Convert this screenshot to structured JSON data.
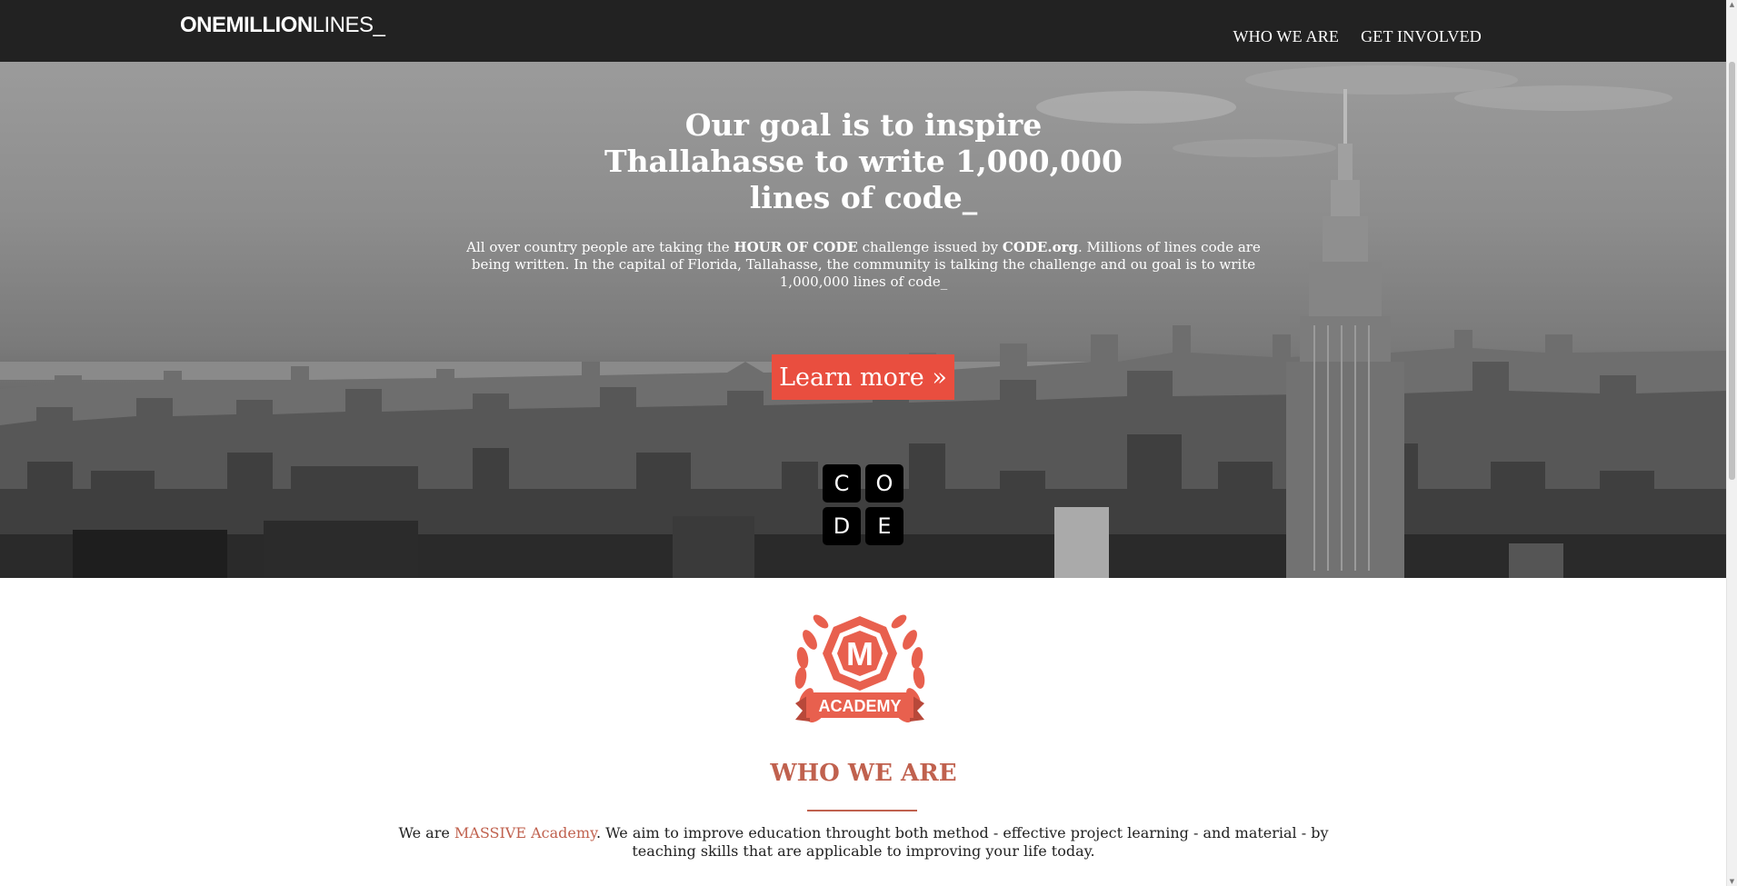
{
  "navbar": {
    "brand_bold": "ONEMILLION",
    "brand_light": "LINES_",
    "links": [
      {
        "label": "WHO WE ARE"
      },
      {
        "label": "GET INVOLVED"
      }
    ]
  },
  "hero": {
    "title_line1": "Our goal is to inspire",
    "title_line2": "Thallahasse to write 1,000,000",
    "title_line3": "lines of code_",
    "text_part1": "All over country people are taking the ",
    "text_bold1": "HOUR OF CODE",
    "text_part2": " challenge issued by ",
    "text_bold2": "CODE.org",
    "text_part3": ". Millions of lines code are being written. In the capital of Florida, Tallahasse, the community is talking the challenge and ou goal is to write 1,000,000 lines of code_",
    "button_label": "Learn more »",
    "code_logo_letters": [
      "C",
      "O",
      "D",
      "E"
    ]
  },
  "about": {
    "logo_letter": "M",
    "logo_text": "ACADEMY",
    "section_title": "WHO WE ARE",
    "text_part1": "We are ",
    "link_text": "MASSIVE Academy",
    "text_part2": ". We aim to improve education throught both method - effective project learning - and material - by teaching skills that are applicable to improving your life today."
  },
  "colors": {
    "navbar_bg": "#222222",
    "accent": "#e94e3f",
    "academy_red": "#c0614e"
  }
}
